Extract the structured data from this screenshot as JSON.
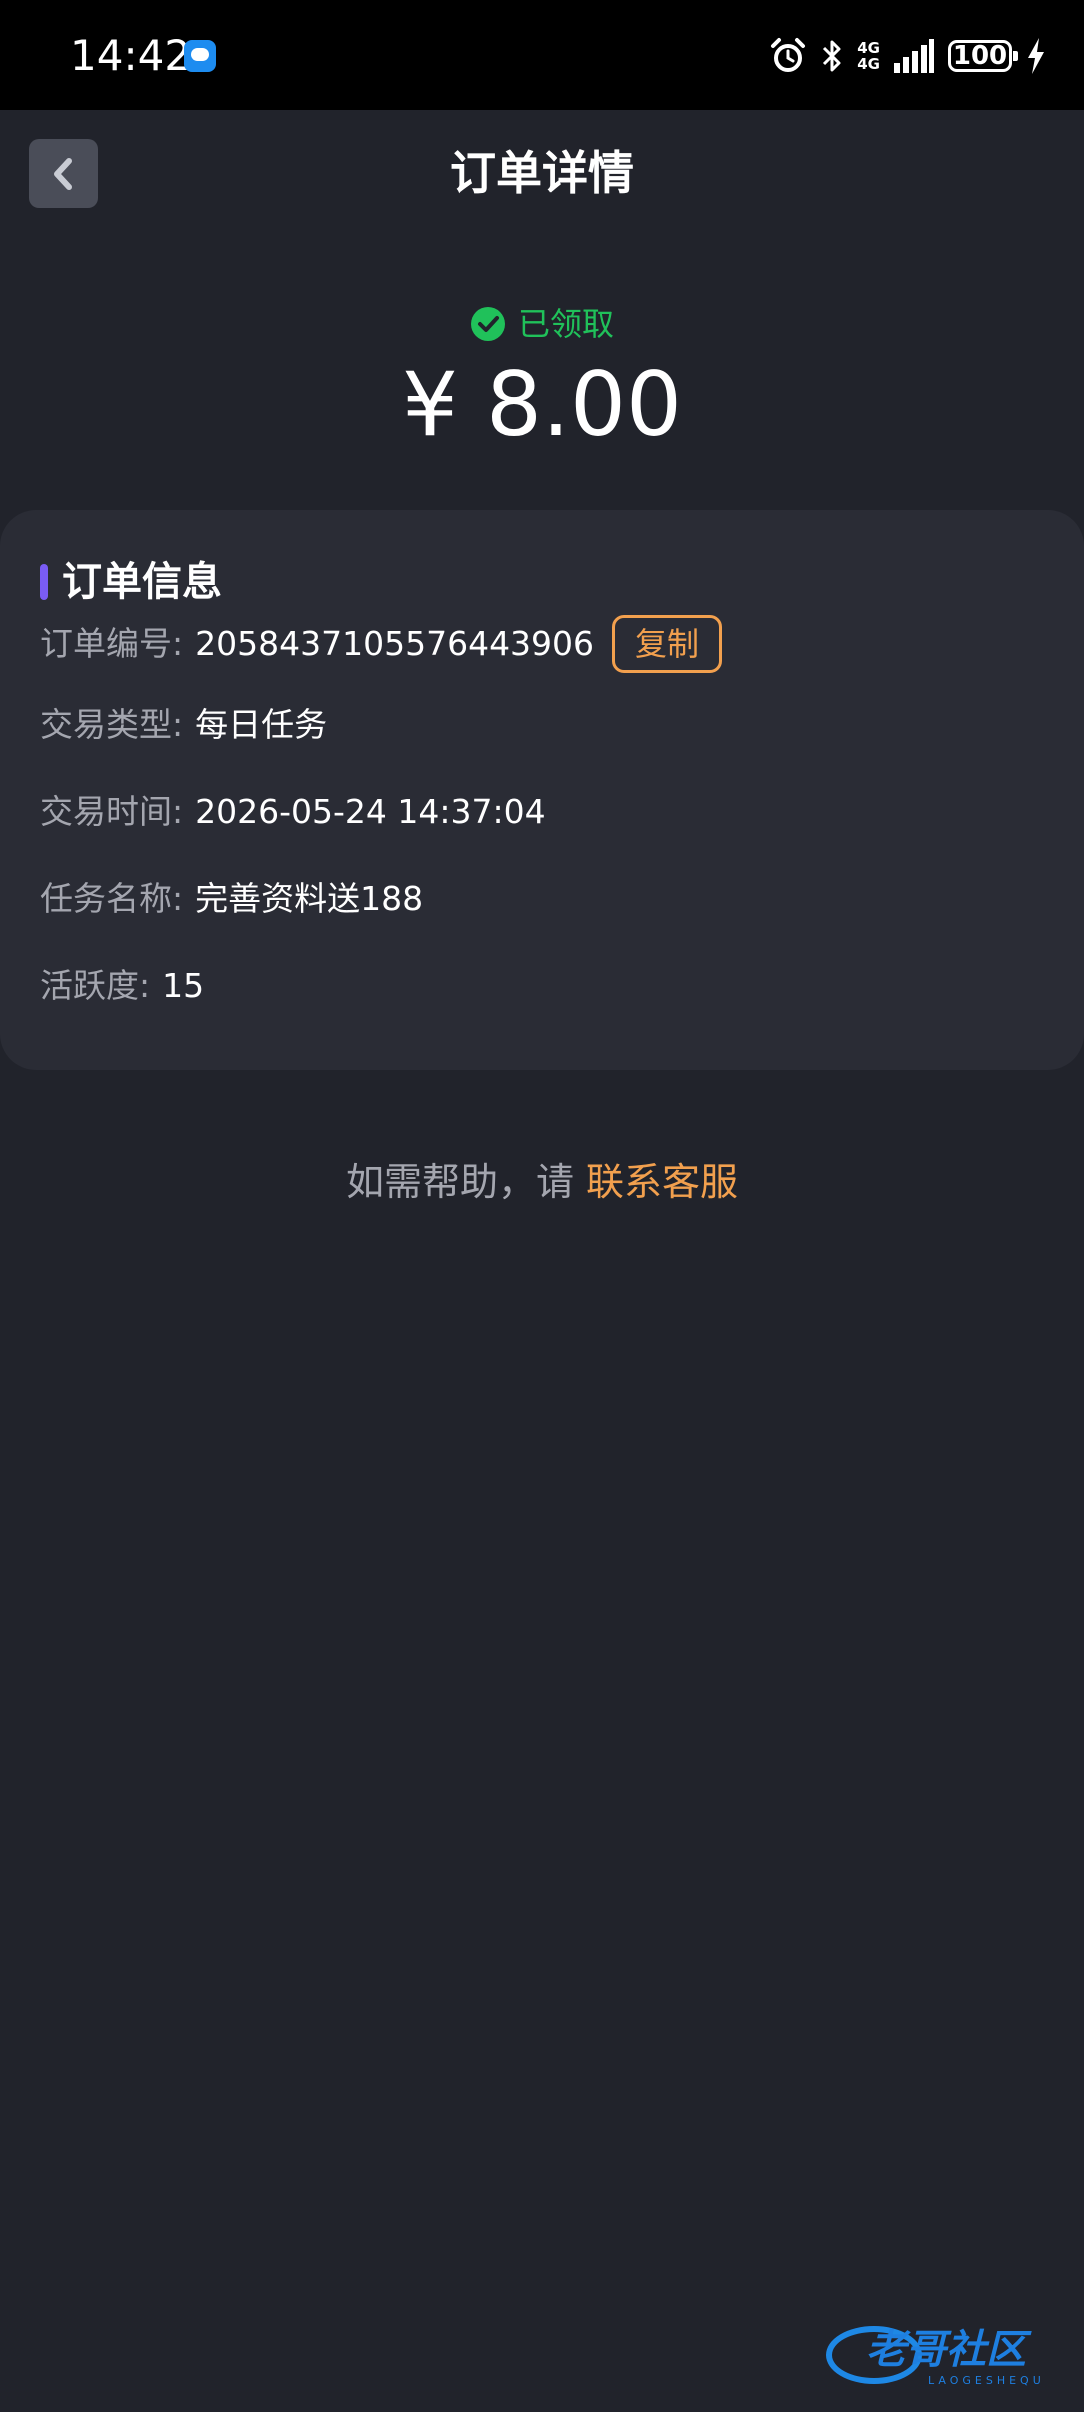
{
  "status_bar": {
    "time": "14:42",
    "network": "4G",
    "network_sub": "4G",
    "battery": "100"
  },
  "header": {
    "title": "订单详情"
  },
  "order_status": {
    "status": "已领取",
    "amount": "¥ 8.00"
  },
  "card": {
    "title": "订单信息",
    "rows": [
      {
        "label": "订单编号:",
        "value": "2058437105576443906"
      },
      {
        "label": "交易类型:",
        "value": "每日任务"
      },
      {
        "label": "交易时间:",
        "value": "2026-05-24 14:37:04"
      },
      {
        "label": "任务名称:",
        "value": "完善资料送188"
      },
      {
        "label": "活跃度:",
        "value": "15"
      }
    ],
    "copy_label": "复制"
  },
  "help": {
    "text": "如需帮助，请 ",
    "link": "联系客服"
  },
  "watermark": {
    "text": "老哥社区",
    "sub": "LAOGESHEQU"
  },
  "colors": {
    "background": "#21232b",
    "card": "#2a2c35",
    "accent_orange": "#f2a04e",
    "success_green": "#20c15a",
    "title_bar_purple": "#7a5cf5"
  },
  "icons": {
    "back": "chevron-left-icon",
    "status": "check-circle-icon",
    "alarm": "alarm-icon",
    "bluetooth": "bluetooth-icon",
    "signal": "signal-icon",
    "battery": "battery-icon",
    "charging": "bolt-icon",
    "notification": "message-icon"
  }
}
